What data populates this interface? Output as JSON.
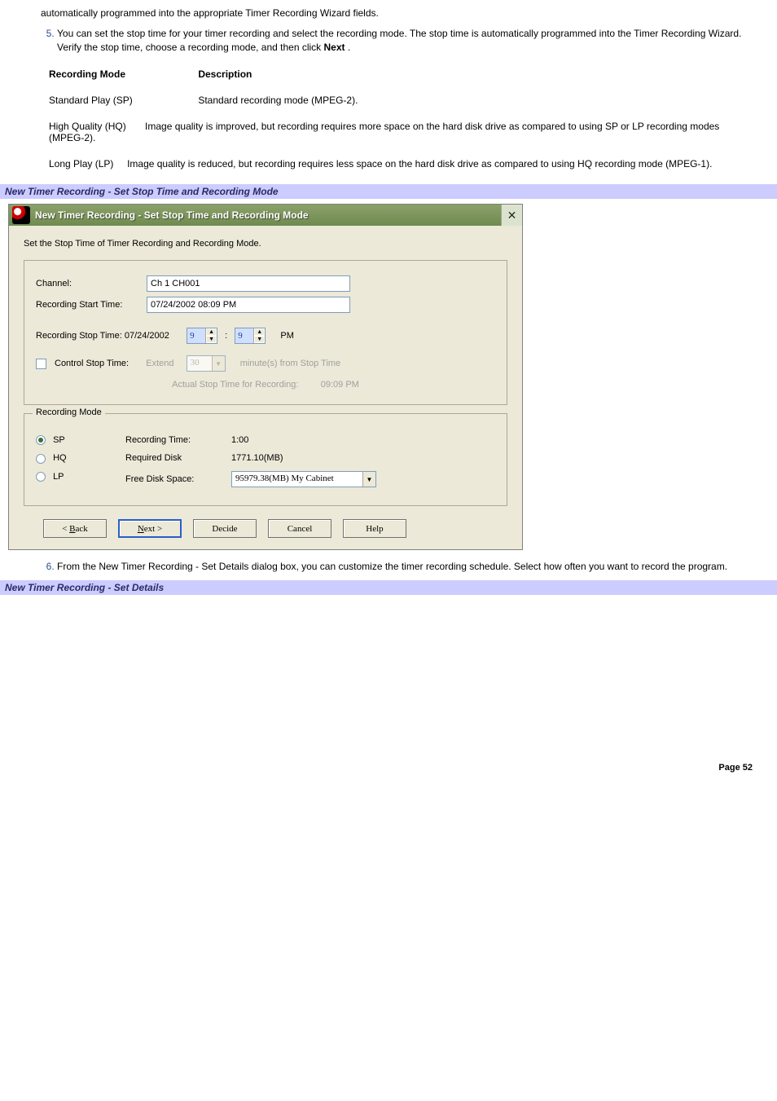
{
  "top_para": "automatically programmed into the appropriate Timer Recording Wizard fields.",
  "step5": {
    "num": "5.",
    "text_pre": "You can set the stop time for your timer recording and select the recording mode. The stop time is automatically programmed into the Timer Recording Wizard. Verify the stop time, choose a recording mode, and then click ",
    "text_bold": "Next",
    "text_post": " ."
  },
  "table": {
    "h1": "Recording Mode",
    "h2": "Description",
    "rows": [
      {
        "c1": "Standard Play (SP)",
        "c2": "Standard recording mode (MPEG-2)."
      },
      {
        "c1": "High Quality (HQ)",
        "c2": "Image quality is improved, but recording requires more space on the hard disk drive as compared to using SP or LP recording modes (MPEG-2)."
      },
      {
        "c1": "Long Play (LP)",
        "c2": "Image quality is reduced, but recording requires less space on the hard disk drive as compared to using HQ recording mode (MPEG-1)."
      }
    ]
  },
  "band1": "New Timer Recording - Set Stop Time and Recording Mode",
  "dialog": {
    "title": "New Timer Recording - Set Stop Time and Recording Mode",
    "instr": "Set the Stop Time of Timer Recording and Recording Mode.",
    "channel_lbl": "Channel:",
    "channel_val": "Ch 1 CH001",
    "start_lbl": "Recording Start Time:",
    "start_val": "07/24/2002 08:09 PM",
    "stop_lbl": "Recording Stop Time: 07/24/2002",
    "stop_h": "9",
    "stop_m": "9",
    "stop_ampm": "PM",
    "ctrl_lbl": "Control Stop Time:",
    "extend_lbl": "Extend",
    "extend_val": "30",
    "extend_unit": "minute(s) from Stop Time",
    "actual_lbl": "Actual Stop Time for Recording:",
    "actual_val": "09:09 PM",
    "recmode_legend": "Recording Mode",
    "opt_sp": "SP",
    "opt_hq": "HQ",
    "opt_lp": "LP",
    "rectime_lbl": "Recording Time:",
    "rectime_val": "1:00",
    "reqdisk_lbl": "Required Disk",
    "reqdisk_val": "1771.10(MB)",
    "freedisk_lbl": "Free Disk Space:",
    "freedisk_val": "95979.38(MB) My Cabinet",
    "btn_back_u": "B",
    "btn_back": "ack",
    "btn_next_u": "N",
    "btn_next": "ext >",
    "btn_decide": "Decide",
    "btn_cancel": "Cancel",
    "btn_help": "Help"
  },
  "step6": {
    "num": "6.",
    "text": "From the New Timer Recording - Set Details dialog box, you can customize the timer recording schedule. Select how often you want to record the program."
  },
  "band2": "New Timer Recording - Set Details",
  "footer": "Page 52"
}
